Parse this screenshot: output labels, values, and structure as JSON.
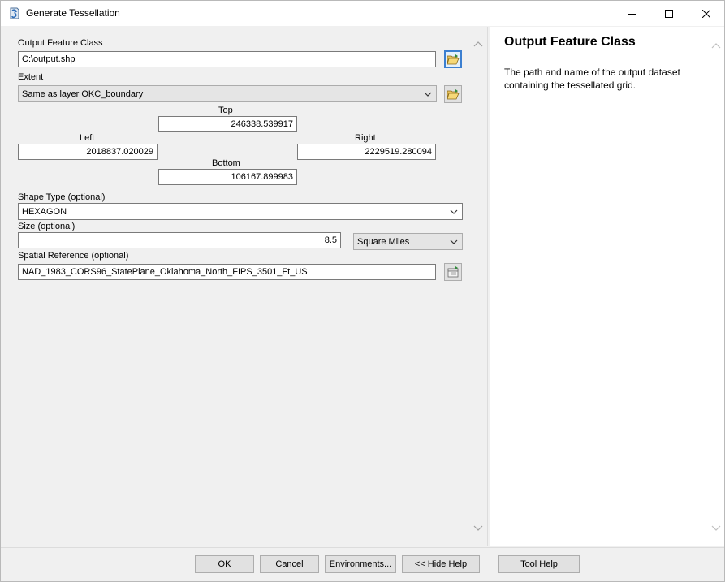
{
  "window": {
    "title": "Generate Tessellation"
  },
  "form": {
    "output_label": "Output Feature Class",
    "output_value": "C:\\output.shp",
    "extent_label": "Extent",
    "extent_value": "Same as layer OKC_boundary",
    "top_label": "Top",
    "top_value": "246338.539917",
    "left_label": "Left",
    "left_value": "2018837.020029",
    "right_label": "Right",
    "right_value": "2229519.280094",
    "bottom_label": "Bottom",
    "bottom_value": "106167.899983",
    "shape_label": "Shape Type (optional)",
    "shape_value": "HEXAGON",
    "size_label": "Size (optional)",
    "size_value": "8.5",
    "size_unit": "Square Miles",
    "sr_label": "Spatial Reference (optional)",
    "sr_value": "NAD_1983_CORS96_StatePlane_Oklahoma_North_FIPS_3501_Ft_US"
  },
  "help": {
    "title": "Output Feature Class",
    "text": "The path and name of the output dataset containing the tessellated grid."
  },
  "buttons": {
    "ok": "OK",
    "cancel": "Cancel",
    "environments": "Environments...",
    "hide_help": "<< Hide Help",
    "tool_help": "Tool Help"
  },
  "icons": {
    "app": "python-script-icon",
    "browse": "folder-open-icon",
    "sr_browse": "spatial-reference-icon"
  }
}
